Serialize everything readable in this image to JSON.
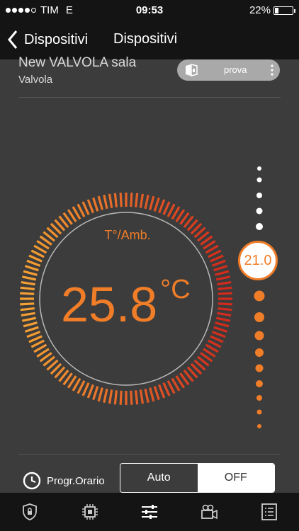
{
  "status_bar": {
    "carrier": "TIM",
    "network": "E",
    "time": "09:53",
    "battery_percent": "22%",
    "battery_level": 0.22,
    "signal_strength": 4
  },
  "nav": {
    "back_label": "Dispositivi",
    "title": "Dispositivi"
  },
  "device": {
    "name": "New VALVOLA sala",
    "type": "Valvola",
    "group_label": "prova",
    "group_icon": "room-icon"
  },
  "thermostat": {
    "label": "T°/Amb.",
    "temperature": "25.8",
    "unit": "°C",
    "setpoint": "21.0"
  },
  "mode": {
    "schedule_label": "Progr.Orario",
    "options": [
      "Auto",
      "OFF"
    ],
    "selected": "OFF"
  },
  "tabs": [
    {
      "name": "security-tab",
      "icon": "shield-lock-icon"
    },
    {
      "name": "devices-tab",
      "icon": "chip-icon"
    },
    {
      "name": "controls-tab",
      "icon": "sliders-icon"
    },
    {
      "name": "camera-tab",
      "icon": "video-camera-icon"
    },
    {
      "name": "log-tab",
      "icon": "list-icon"
    }
  ],
  "colors": {
    "accent": "#f07d28",
    "arc_hot": "#d42a1c",
    "arc_warm": "#f5a033",
    "background": "#3c3c3c",
    "bar": "#141414"
  }
}
